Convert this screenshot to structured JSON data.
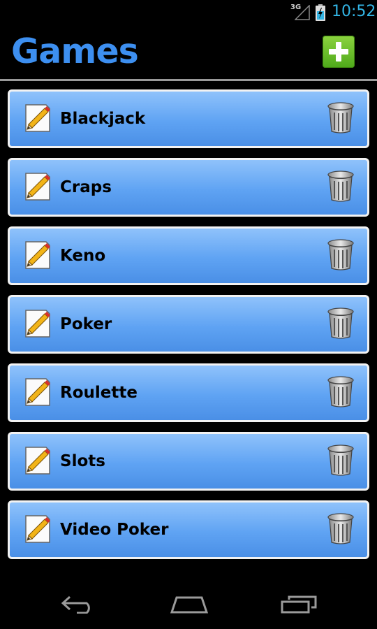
{
  "status_bar": {
    "network": "3G",
    "time": "10:52"
  },
  "header": {
    "title": "Games",
    "add_icon": "plus-icon",
    "accent": "#3d8ff0"
  },
  "games": [
    {
      "label": "Blackjack"
    },
    {
      "label": "Craps"
    },
    {
      "label": "Keno"
    },
    {
      "label": "Poker"
    },
    {
      "label": "Roulette"
    },
    {
      "label": "Slots"
    },
    {
      "label": "Video Poker"
    }
  ],
  "icons": {
    "edit": "pencil-paper-icon",
    "delete": "trash-can-icon"
  },
  "nav_bar": {
    "back": "back-icon",
    "home": "home-icon",
    "recent": "recent-apps-icon"
  }
}
